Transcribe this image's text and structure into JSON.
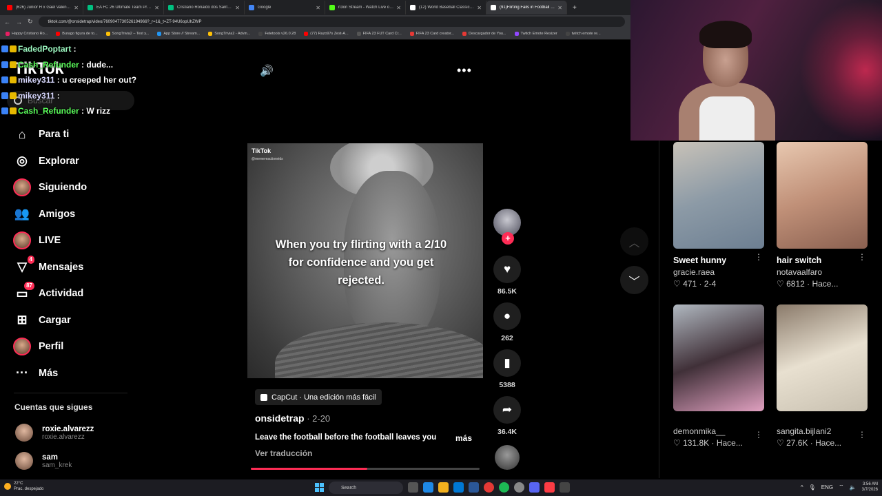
{
  "browser": {
    "tabs": [
      {
        "label": "(626) Junior H x Gael Valenzuela",
        "color": "#ff0000"
      },
      {
        "label": "EA FC 26 Ultimate Team Prices",
        "color": "#00c080"
      },
      {
        "label": "Cristiano Ronaldo dos Santos A",
        "color": "#00c080"
      },
      {
        "label": "Google",
        "color": "#4285f4"
      },
      {
        "label": "n3on Stream - Watch Live on Kick",
        "color": "#53fc18"
      },
      {
        "label": "(12) World Baseball Classic on X",
        "color": "#ffffff"
      },
      {
        "label": "(91)Flirting Fails in Football Me",
        "color": "#ffffff"
      }
    ],
    "url": "tiktok.com/@onsidetrap/video/7609047730526194966?_r=1&_t=ZT-94U6opUhZWP",
    "bookmarks": [
      "Happy Cristiano Ro...",
      "Burago figura de to...",
      "SongTrivia2 – Test y...",
      "App Store // Stream...",
      "SongTrivia2 - Advin...",
      "Feletools v26.0.28",
      "(77) Razo97s Zest-A...",
      "FIFA 23 FUT Card Cr...",
      "FIFA 23 Card creator...",
      "Descargador de You...",
      "Twitch Emote Resizer",
      "twitch emote re..."
    ]
  },
  "chat": [
    {
      "user": "FadedPoptart",
      "text": "",
      "color": "u1"
    },
    {
      "user": "Cash_Refunder",
      "text": "dude...",
      "color": "u2"
    },
    {
      "user": "mikey311",
      "text": "u creeped her out?",
      "color": "u3"
    },
    {
      "user": "mikey311",
      "text": "",
      "color": "u3"
    },
    {
      "user": "Cash_Refunder",
      "text": "W rizz",
      "color": "u2"
    }
  ],
  "sidebar": {
    "logo": "TikTok",
    "search_placeholder": "Buscar",
    "items": [
      {
        "label": "Para ti",
        "icon": "home-icon",
        "badge": ""
      },
      {
        "label": "Explorar",
        "icon": "compass-icon",
        "badge": ""
      },
      {
        "label": "Siguiendo",
        "icon": "avatar",
        "badge": ""
      },
      {
        "label": "Amigos",
        "icon": "friends-icon",
        "badge": ""
      },
      {
        "label": "LIVE",
        "icon": "avatar",
        "badge": ""
      },
      {
        "label": "Mensajes",
        "icon": "send-icon",
        "badge": "4"
      },
      {
        "label": "Actividad",
        "icon": "inbox-icon",
        "badge": "87"
      },
      {
        "label": "Cargar",
        "icon": "plus-square-icon",
        "badge": ""
      },
      {
        "label": "Perfil",
        "icon": "avatar",
        "badge": ""
      },
      {
        "label": "Más",
        "icon": "more-icon",
        "badge": ""
      }
    ],
    "follows_title": "Cuentas que sigues",
    "accounts": [
      {
        "name": "roxie.alvarezz",
        "handle": "roxie.alvarezz"
      },
      {
        "name": "sam",
        "handle": "sam_krek"
      }
    ]
  },
  "video": {
    "watermark": "TikTok",
    "watermark_handle": "@memereactionvids",
    "caption": "When you try flirting with a 2/10 for confidence and you get rejected.",
    "likes": "86.5K",
    "comments": "262",
    "saves": "5388",
    "shares": "36.4K",
    "capcut": "CapCut · Una edición más fácil",
    "author": "onsidetrap",
    "date": "2-20",
    "description": "Leave the football before the football leaves you",
    "more": "más",
    "translate": "Ver traducción",
    "progress": 0.51
  },
  "grid": [
    {
      "title": "Sweet hunny",
      "author": "gracie.raea",
      "likes": "471",
      "time": "2-4",
      "bg": "linear-gradient(160deg,#c8c2b8,#8c9aa6 50%,#6d7f92)"
    },
    {
      "title": "hair switch",
      "author": "notavaalfaro",
      "likes": "6812",
      "time": "Hace...",
      "bg": "linear-gradient(160deg,#e8c8b0,#c09078 50%,#8a6050)"
    },
    {
      "title": "",
      "author": "demonmika__",
      "likes": "131.8K",
      "time": "Hace...",
      "bg": "linear-gradient(160deg,#b0b8c0,#403038 50%,#e0a0c0)"
    },
    {
      "title": "",
      "author": "sangita.bijlani2",
      "likes": "27.6K",
      "time": "Hace...",
      "bg": "linear-gradient(160deg,#8a7a6a,#e8e0d0 50%,#c8c0b0)"
    }
  ],
  "taskbar": {
    "temp": "22°C",
    "weather": "Prac. despejado",
    "search": "Search",
    "lang": "ENG",
    "time": "3:56 AM",
    "date": "3/7/2026"
  }
}
